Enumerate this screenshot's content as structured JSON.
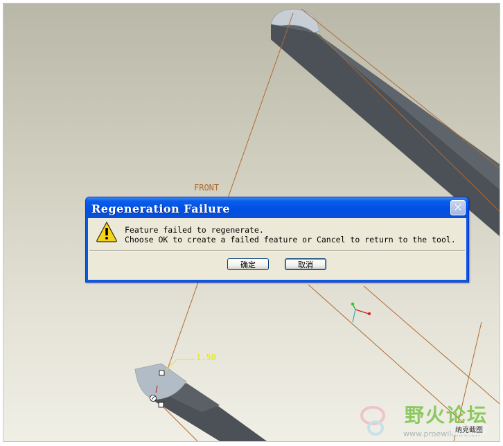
{
  "dialog": {
    "title": "Regeneration Failure",
    "close_glyph": "✕",
    "message_line1": "Feature failed to regenerate.",
    "message_line2": "Choose OK to create a failed feature or Cancel to return to the tool.",
    "ok_label": "确定",
    "cancel_label": "取消",
    "icon": "warning-icon"
  },
  "viewport": {
    "datum_label": "FRONT",
    "dimension_value": "1.50"
  },
  "watermark": {
    "logo_text": "野火论坛",
    "caption": "纳克截图",
    "url": "www.proewildfire.cn"
  },
  "colors": {
    "datum_edge": "#b06a32",
    "dimension": "#e8e800",
    "title_bar": "#0a5de8",
    "dialog_body": "#ece9d8"
  }
}
